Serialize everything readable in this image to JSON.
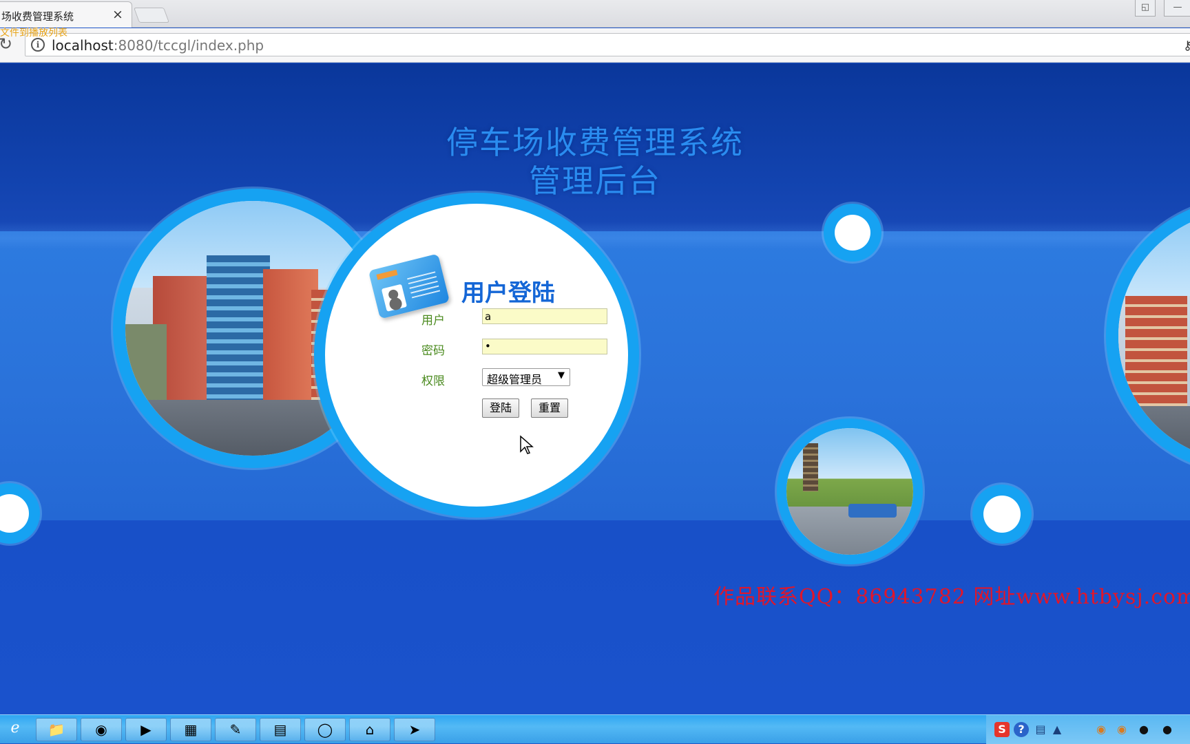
{
  "browser": {
    "tab_title": "场收费管理系统",
    "tab_close": "×",
    "hint": "文件到播放列表",
    "url_host": "localhost",
    "url_rest": ":8080/tccgl/index.php"
  },
  "page": {
    "title": "停车场收费管理系统",
    "subtitle": "管理后台"
  },
  "login": {
    "heading": "用户登陆",
    "user_label": "用户",
    "user_value": "a",
    "password_label": "密码",
    "password_value": "•",
    "role_label": "权限",
    "role_selected": "超级管理员",
    "role_caret": "▼",
    "login_button": "登陆",
    "reset_button": "重置"
  },
  "watermark": "作品联系QQ：86943782 网址www.htbysj.com",
  "taskbar": {
    "items": [
      "ie-icon",
      "folder-icon",
      "firefox-icon",
      "player-icon",
      "book-icon",
      "paint-icon",
      "notepad-icon",
      "chrome-icon",
      "house-icon",
      "app-icon"
    ],
    "tray": [
      "sogou-icon",
      "help-icon",
      "network-icon",
      "arrow-up-icon",
      "cat-icon",
      "cat-icon",
      "qq-icon",
      "qq-icon"
    ]
  },
  "colors": {
    "title": "#2a8cf0",
    "ring": "#16a2f2",
    "watermark": "#e0162b",
    "label": "#4a8a1e",
    "input_bg": "#fbfbc8"
  }
}
